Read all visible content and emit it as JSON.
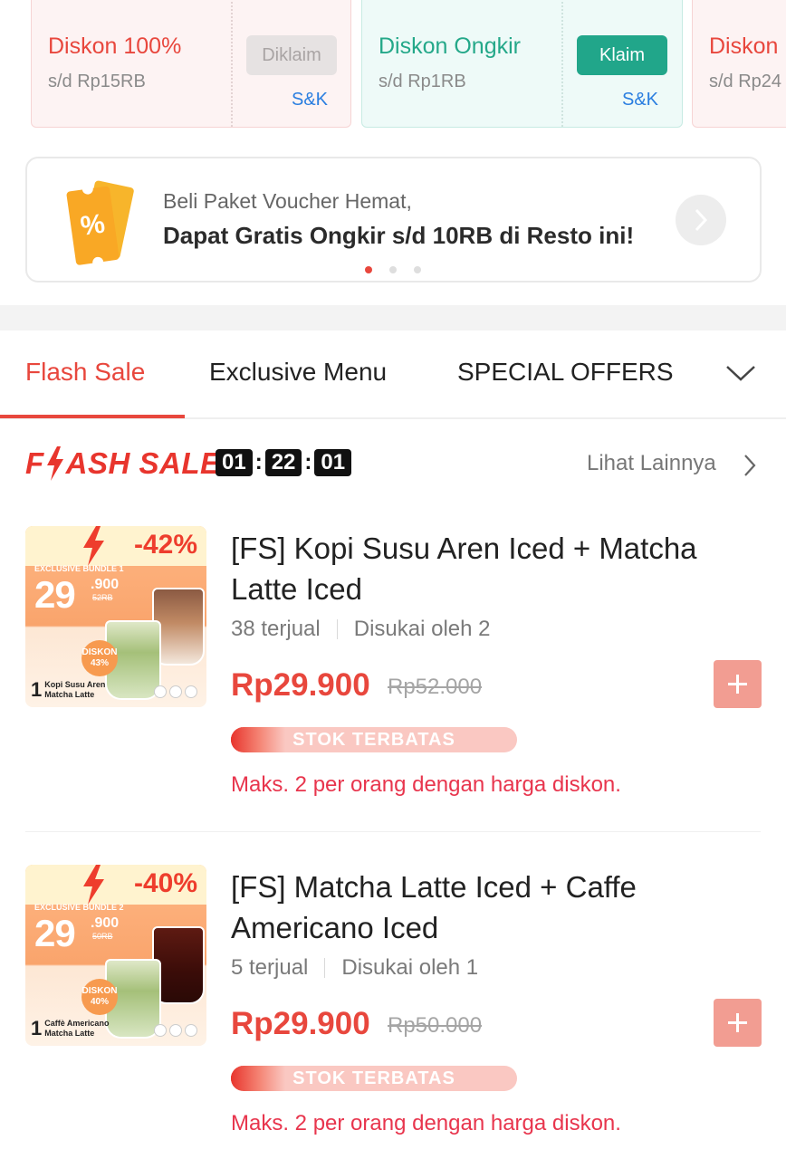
{
  "vouchers": [
    {
      "title": "Diskon 100%",
      "subtitle": "s/d Rp15RB",
      "button": "Diklaim",
      "terms": "S&K",
      "state": "claimed"
    },
    {
      "title": "Diskon Ongkir",
      "subtitle": "s/d Rp1RB",
      "button": "Klaim",
      "terms": "S&K",
      "state": "claimable"
    },
    {
      "title": "Diskon",
      "subtitle": "s/d Rp24"
    }
  ],
  "promo": {
    "line1": "Beli Paket Voucher Hemat,",
    "line2": "Dapat Gratis Ongkir s/d 10RB di Resto ini!",
    "icon": "voucher-ticket-icon",
    "arrow_icon": "chevron-right-icon",
    "pagination": {
      "count": 3,
      "active": 1
    }
  },
  "tabs": {
    "items": [
      "Flash Sale",
      "Exclusive Menu",
      "SPECIAL OFFERS"
    ],
    "active": "Flash Sale",
    "expand_icon": "chevron-down-icon"
  },
  "flash_sale": {
    "logo_left": "F",
    "logo_right": "ASH SALE",
    "timer": {
      "hours": "01",
      "minutes": "22",
      "seconds": "01"
    },
    "see_more": "Lihat Lainnya"
  },
  "products": [
    {
      "title": "[FS] Kopi Susu Aren Iced + Matcha Latte Iced",
      "sold": "38 terjual",
      "liked": "Disukai oleh 2",
      "price": "Rp29.900",
      "original_price": "Rp52.000",
      "stock_label": "STOK TERBATAS",
      "stock_level": 0.06,
      "limit": "Maks. 2 per orang dengan harga diskon.",
      "image": {
        "discount": "-42%",
        "bundle": "EXCLUSIVE BUNDLE 1",
        "price_big": "29",
        "price_small": ".900",
        "price_strike": "52RB",
        "badge_top": "DISKON",
        "badge_value": "43%",
        "caption_number": "1",
        "caption_line1": "Kopi Susu Aren",
        "caption_line2": "Matcha Latte"
      }
    },
    {
      "title": "[FS] Matcha Latte Iced + Caffe Americano Iced",
      "sold": "5 terjual",
      "liked": "Disukai oleh 1",
      "price": "Rp29.900",
      "original_price": "Rp50.000",
      "stock_label": "STOK TERBATAS",
      "stock_level": 0.06,
      "limit": "Maks. 2 per orang dengan harga diskon.",
      "image": {
        "discount": "-40%",
        "bundle": "EXCLUSIVE BUNDLE 2",
        "price_big": "29",
        "price_small": ".900",
        "price_strike": "50RB",
        "badge_top": "DISKON",
        "badge_value": "40%",
        "caption_number": "1",
        "caption_line1": "Caffè Americano",
        "caption_line2": "Matcha Latte"
      }
    }
  ],
  "colors": {
    "accent": "#e8473d",
    "claim_green": "#21a68a",
    "link_blue": "#2a7ee0",
    "limit_text": "#e8354d"
  }
}
